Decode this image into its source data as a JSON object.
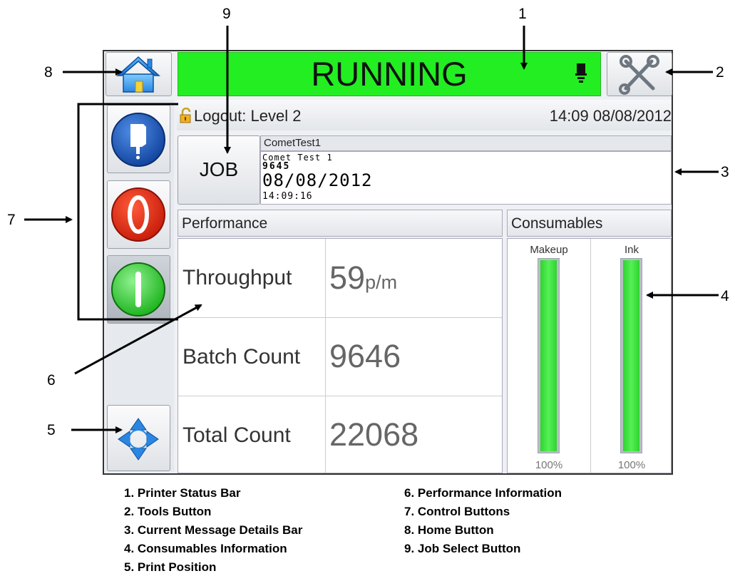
{
  "callouts": [
    "1",
    "2",
    "3",
    "4",
    "5",
    "6",
    "7",
    "8",
    "9"
  ],
  "status": {
    "text": "RUNNING",
    "color": "#22ee22"
  },
  "info_bar": {
    "logout": "Logout: Level 2",
    "datetime": "14:09 08/08/2012"
  },
  "job": {
    "label": "JOB",
    "message_name": "CometTest1",
    "lines": [
      "Comet Test 1",
      "9645",
      "08/08/2012",
      "14:09:16"
    ]
  },
  "performance": {
    "title": "Performance",
    "rows": [
      {
        "label": "Throughput",
        "value": "59",
        "unit": "p/m"
      },
      {
        "label": "Batch Count",
        "value": "9646"
      },
      {
        "label": "Total Count",
        "value": "22068"
      }
    ]
  },
  "consumables": {
    "title": "Consumables",
    "items": [
      {
        "label": "Makeup",
        "percent": "100%",
        "level": 1.0
      },
      {
        "label": "Ink",
        "percent": "100%",
        "level": 1.0
      }
    ]
  },
  "legend": {
    "left": [
      "1. Printer Status Bar",
      "2. Tools Button",
      "3. Current Message Details Bar",
      "4. Consumables Information",
      "5. Print Position"
    ],
    "right": [
      "6. Performance Information",
      "7. Control Buttons",
      "8. Home Button",
      "9. Job Select Button"
    ]
  },
  "icons": {
    "home": "home-icon",
    "tools": "tools-icon",
    "printhead": "printhead-icon",
    "padlock": "padlock-icon",
    "ink": "ink-icon",
    "stop": "stop-icon",
    "start": "start-icon",
    "print_position": "print-position-icon"
  }
}
